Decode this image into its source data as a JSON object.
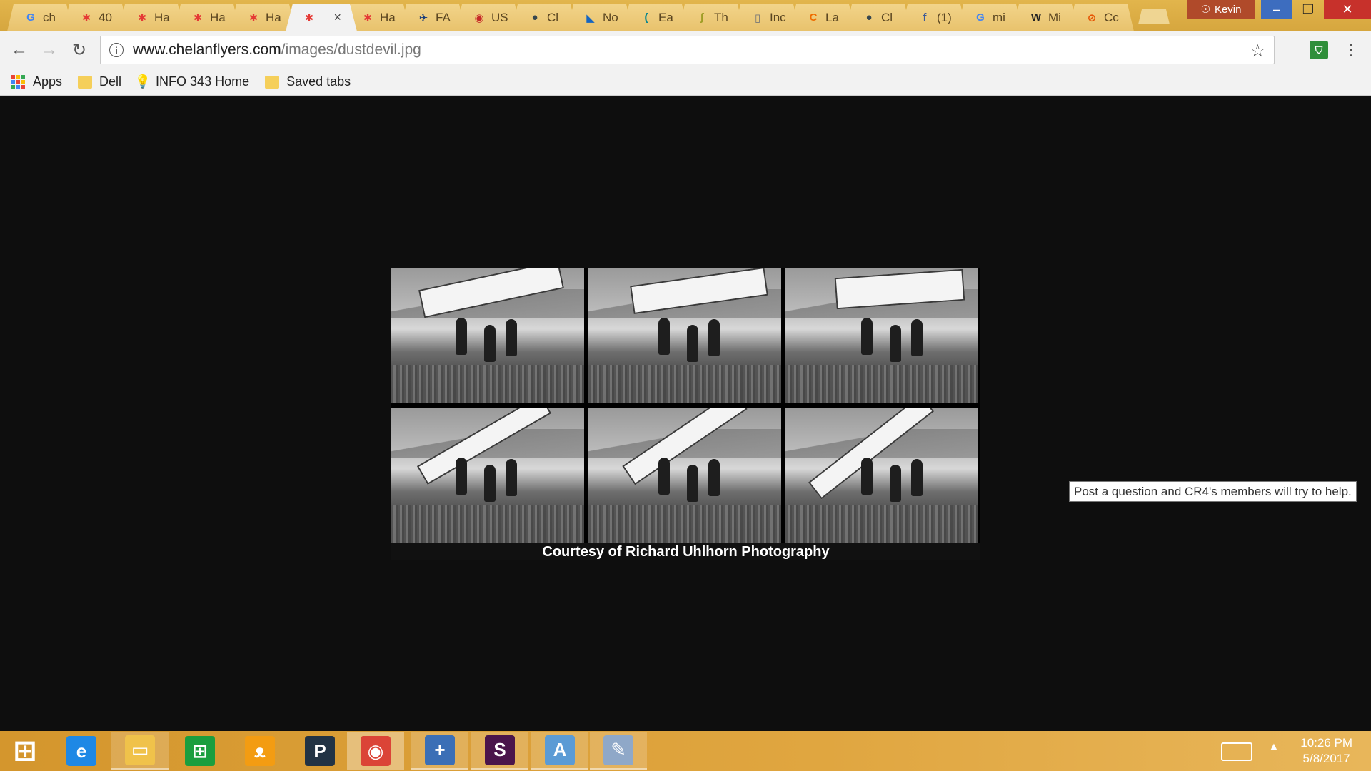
{
  "browser": {
    "tabs": [
      {
        "label": "ch",
        "icon": "G",
        "icon_color": "#4285f4"
      },
      {
        "label": "40",
        "icon": "✱",
        "icon_color": "#e53935"
      },
      {
        "label": "Ha",
        "icon": "✱",
        "icon_color": "#e53935"
      },
      {
        "label": "Ha",
        "icon": "✱",
        "icon_color": "#e53935"
      },
      {
        "label": "Ha",
        "icon": "✱",
        "icon_color": "#e53935"
      },
      {
        "label": "",
        "icon": "✱",
        "icon_color": "#e53935",
        "active": true
      },
      {
        "label": "Ha",
        "icon": "✱",
        "icon_color": "#e53935"
      },
      {
        "label": "FA",
        "icon": "✈",
        "icon_color": "#1a3e7a"
      },
      {
        "label": "US",
        "icon": "◉",
        "icon_color": "#c62828"
      },
      {
        "label": "Cl",
        "icon": "●",
        "icon_color": "#37474f"
      },
      {
        "label": "No",
        "icon": "◣",
        "icon_color": "#1565c0"
      },
      {
        "label": "Ea",
        "icon": "(",
        "icon_color": "#00838f"
      },
      {
        "label": "Th",
        "icon": "ʃ",
        "icon_color": "#9e9d24"
      },
      {
        "label": "Inc",
        "icon": "▯",
        "icon_color": "#777777"
      },
      {
        "label": "La",
        "icon": "C",
        "icon_color": "#ef6c00"
      },
      {
        "label": "Cl",
        "icon": "●",
        "icon_color": "#37474f"
      },
      {
        "label": "(1)",
        "icon": "f",
        "icon_color": "#3b5998"
      },
      {
        "label": "mi",
        "icon": "G",
        "icon_color": "#4285f4"
      },
      {
        "label": "Mi",
        "icon": "W",
        "icon_color": "#222222"
      },
      {
        "label": "Cc",
        "icon": "⊘",
        "icon_color": "#e65100"
      }
    ],
    "active_tab_close": "×",
    "user_name": "Kevin",
    "url_domain": "www.chelanflyers.com",
    "url_path": "/images/dustdevil.jpg"
  },
  "bookmarks": [
    {
      "label": "Apps",
      "icon": "apps-grid-icon"
    },
    {
      "label": "Dell",
      "icon": "folder-icon"
    },
    {
      "label": "INFO 343 Home",
      "icon": "lightbulb-icon"
    },
    {
      "label": "Saved tabs",
      "icon": "folder-icon"
    }
  ],
  "content": {
    "caption": "Courtesy of Richard Uhlhorn Photography",
    "tooltip": "Post a question and CR4's members will try to help."
  },
  "taskbar": {
    "time": "10:26 PM",
    "date": "5/8/2017",
    "apps": [
      {
        "name": "start",
        "glyph": "⊞",
        "color": "transparent"
      },
      {
        "name": "internet-explorer",
        "glyph": "e",
        "color": "#1e88e5"
      },
      {
        "name": "file-explorer",
        "glyph": "▭",
        "color": "#f0c24a"
      },
      {
        "name": "store",
        "glyph": "⊞",
        "color": "#1b9e3e"
      },
      {
        "name": "scratch",
        "glyph": "ᴥ",
        "color": "#f39c12"
      },
      {
        "name": "pandora",
        "glyph": "P",
        "color": "#223344"
      },
      {
        "name": "chrome",
        "glyph": "◉",
        "color": "#db4437"
      },
      {
        "name": "tableau",
        "glyph": "+",
        "color": "#3b6fb6"
      },
      {
        "name": "slack",
        "glyph": "S",
        "color": "#4a154b"
      },
      {
        "name": "wordpad",
        "glyph": "A",
        "color": "#5b9bd5"
      },
      {
        "name": "paint",
        "glyph": "✎",
        "color": "#8fa8c8"
      }
    ]
  }
}
